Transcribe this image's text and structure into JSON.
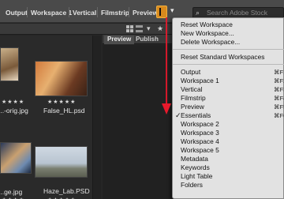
{
  "workspace_bar": {
    "tabs": [
      "Output",
      "Workspace 1",
      "Vertical",
      "Filmstrip",
      "Preview"
    ],
    "search_placeholder": "Search Adobe Stock"
  },
  "panel_tabs": [
    "Preview",
    "Publish"
  ],
  "content": {
    "items": [
      {
        "name": "...-orig.jpg",
        "rating": "★★★★"
      },
      {
        "name": "False_HL.psd",
        "rating": "★★★★★"
      },
      {
        "name": "...ge.jpg",
        "rating": "★★★★"
      },
      {
        "name": "Haze_Lab.PSD",
        "rating": "★★★★★"
      }
    ]
  },
  "menu": {
    "items": [
      {
        "label": "Reset Workspace",
        "shortcut": ""
      },
      {
        "label": "New Workspace...",
        "shortcut": ""
      },
      {
        "label": "Delete Workspace...",
        "shortcut": ""
      },
      {
        "label": "Reset Standard Workspaces",
        "shortcut": ""
      },
      {
        "label": "Output",
        "shortcut": "⌘F1"
      },
      {
        "label": "Workspace 1",
        "shortcut": "⌘F2"
      },
      {
        "label": "Vertical",
        "shortcut": "⌘F3"
      },
      {
        "label": "Filmstrip",
        "shortcut": "⌘F4"
      },
      {
        "label": "Preview",
        "shortcut": "⌘F5"
      },
      {
        "label": "Essentials",
        "shortcut": "⌘F6",
        "checked": true
      },
      {
        "label": "Workspace 2",
        "shortcut": ""
      },
      {
        "label": "Workspace 3",
        "shortcut": ""
      },
      {
        "label": "Workspace 4",
        "shortcut": ""
      },
      {
        "label": "Workspace 5",
        "shortcut": ""
      },
      {
        "label": "Metadata",
        "shortcut": ""
      },
      {
        "label": "Keywords",
        "shortcut": ""
      },
      {
        "label": "Light Table",
        "shortcut": ""
      },
      {
        "label": "Folders",
        "shortcut": ""
      }
    ]
  },
  "colors": {
    "accent": "#d88a1d",
    "annotation_arrow": "#e8192c"
  }
}
